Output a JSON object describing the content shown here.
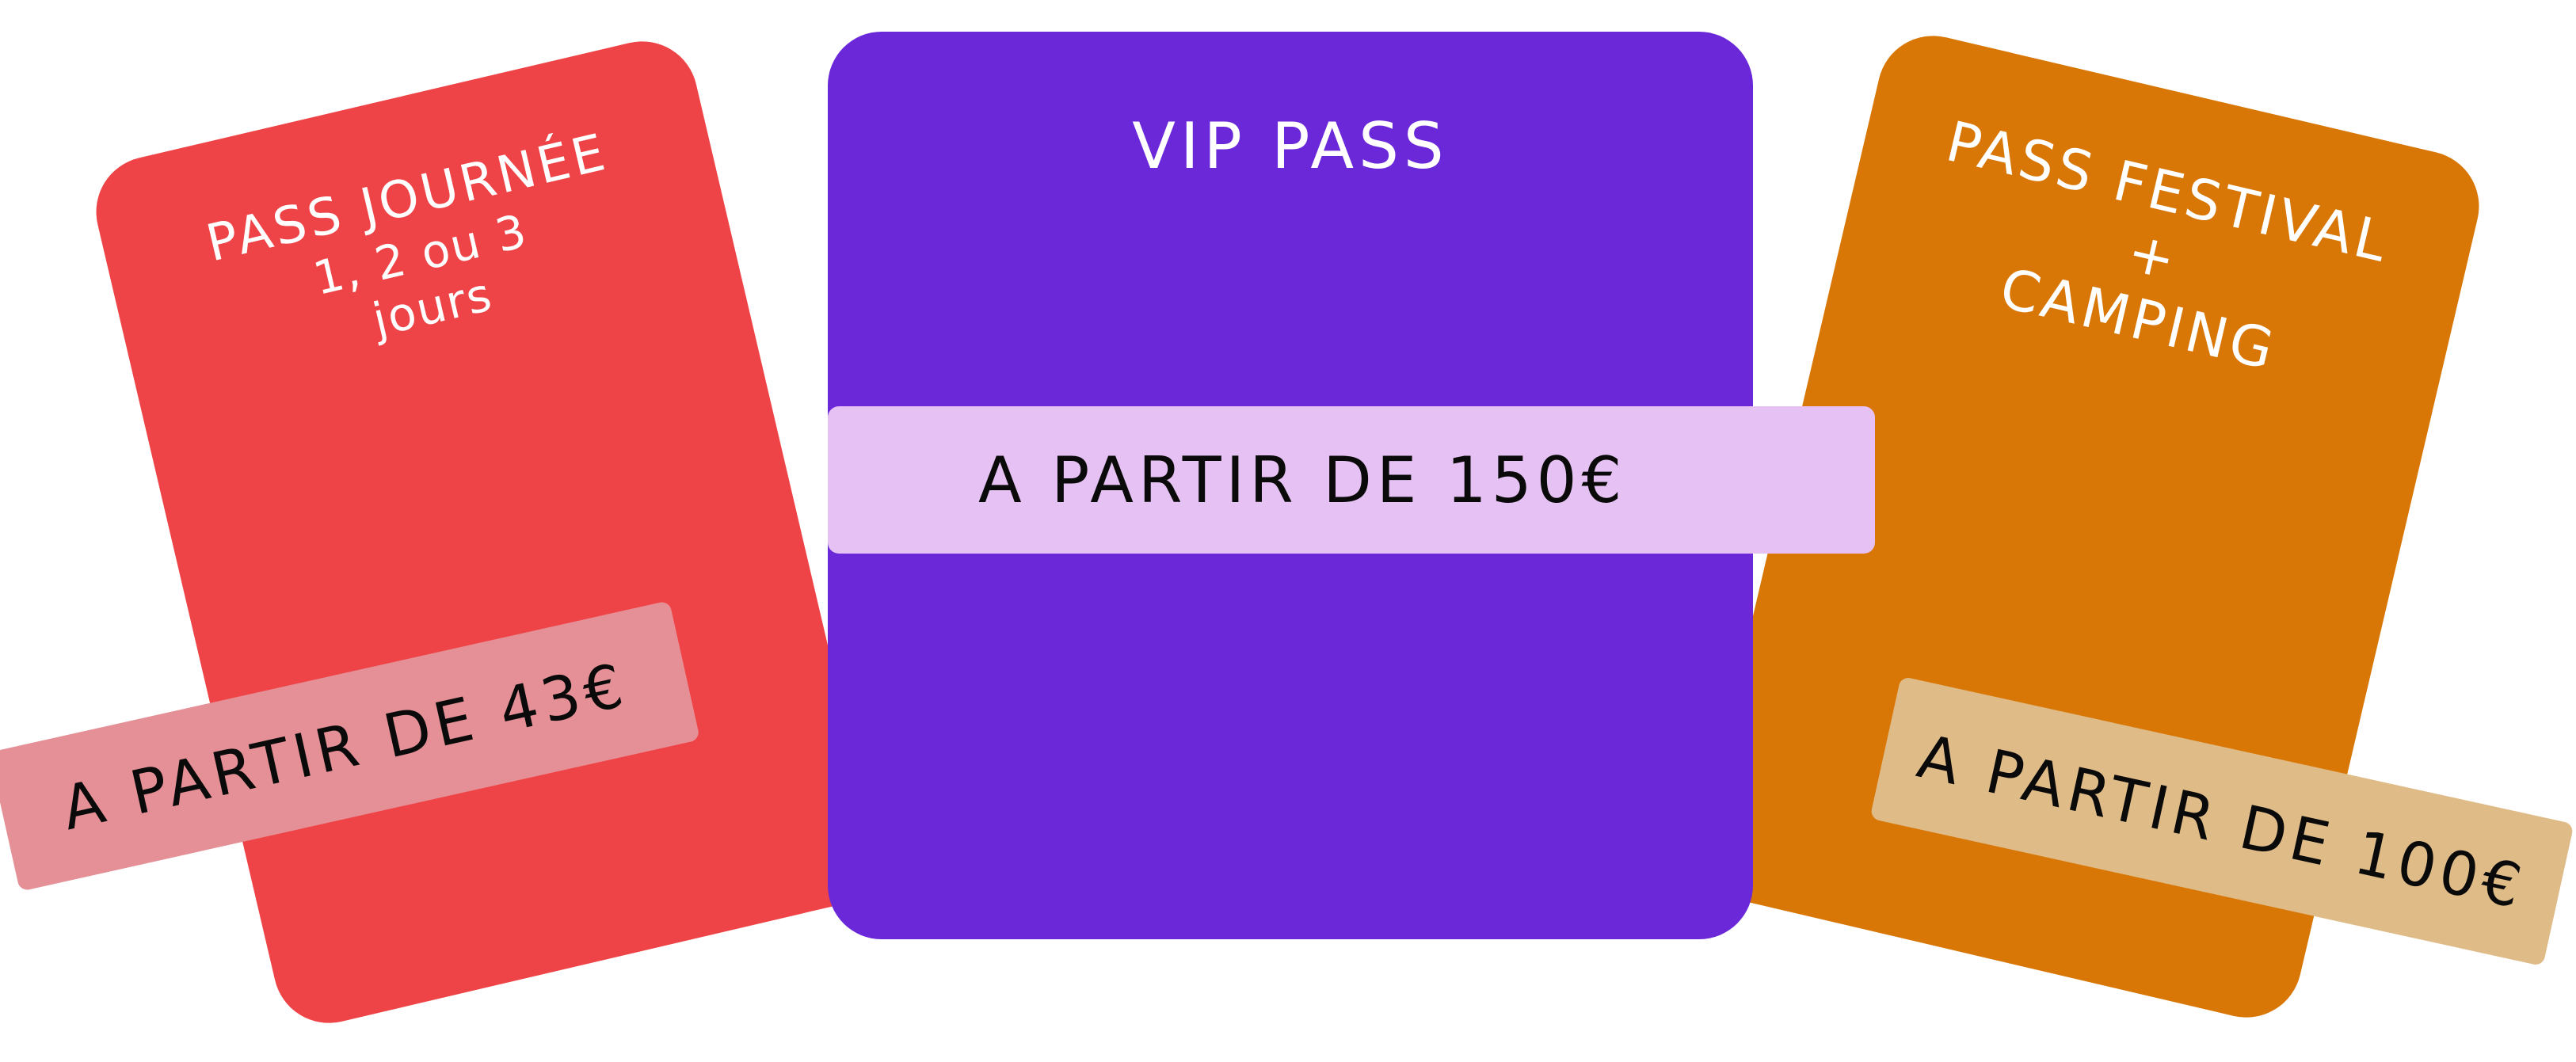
{
  "colors": {
    "journee_card": "#ef4447",
    "journee_tag": "#e59096",
    "vip_card": "#6b28d8",
    "vip_tag": "#e6c1f3",
    "festival_card": "#d97706",
    "festival_tag": "#dfbb87",
    "title_text": "#ffffff",
    "tag_text": "#0a0a0a"
  },
  "cards": {
    "journee": {
      "title": "PASS JOURNÉE",
      "subtitle_line1": "1, 2 ou 3",
      "subtitle_line2": "jours",
      "price": "A PARTIR DE 43€"
    },
    "vip": {
      "title": "VIP PASS",
      "price": "A PARTIR DE 150€"
    },
    "festival": {
      "title_line1": "PASS FESTIVAL",
      "title_line2": "+",
      "title_line3": "CAMPING",
      "price": "A PARTIR DE 100€"
    }
  }
}
